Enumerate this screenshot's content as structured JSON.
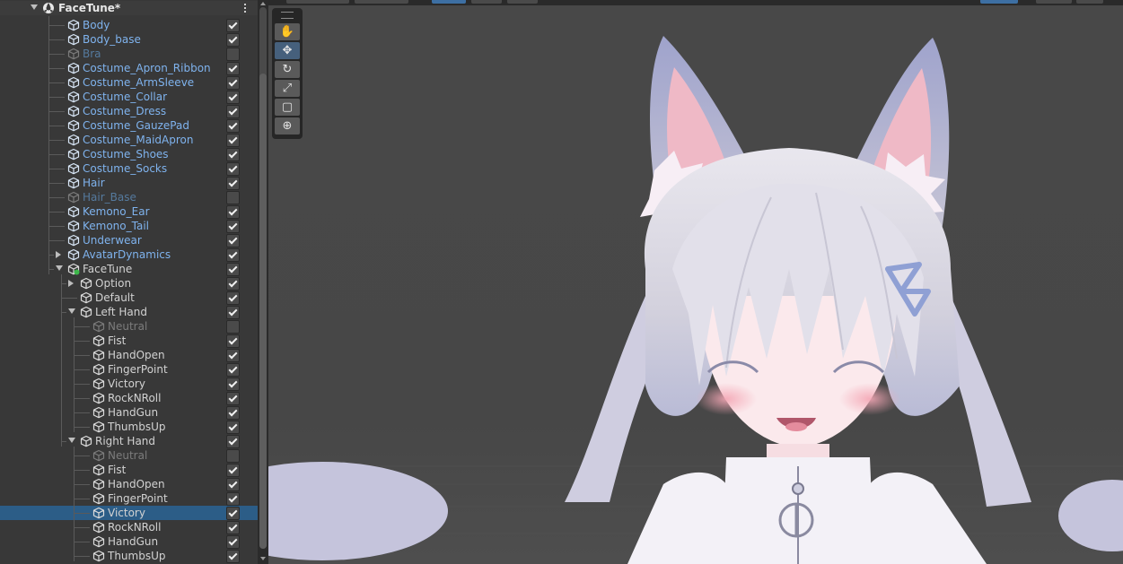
{
  "hierarchy": {
    "root_title": "FaceTune*",
    "rows": [
      {
        "label": "Body",
        "style": "prefab",
        "checked": true,
        "depth": 2
      },
      {
        "label": "Body_base",
        "style": "prefab",
        "checked": true,
        "depth": 2
      },
      {
        "label": "Bra",
        "style": "prefab-off",
        "checked": false,
        "depth": 2
      },
      {
        "label": "Costume_Apron_Ribbon",
        "style": "prefab",
        "checked": true,
        "depth": 2
      },
      {
        "label": "Costume_ArmSleeve",
        "style": "prefab",
        "checked": true,
        "depth": 2
      },
      {
        "label": "Costume_Collar",
        "style": "prefab",
        "checked": true,
        "depth": 2
      },
      {
        "label": "Costume_Dress",
        "style": "prefab",
        "checked": true,
        "depth": 2
      },
      {
        "label": "Costume_GauzePad",
        "style": "prefab",
        "checked": true,
        "depth": 2
      },
      {
        "label": "Costume_MaidApron",
        "style": "prefab",
        "checked": true,
        "depth": 2
      },
      {
        "label": "Costume_Shoes",
        "style": "prefab",
        "checked": true,
        "depth": 2
      },
      {
        "label": "Costume_Socks",
        "style": "prefab",
        "checked": true,
        "depth": 2
      },
      {
        "label": "Hair",
        "style": "prefab",
        "checked": true,
        "depth": 2
      },
      {
        "label": "Hair_Base",
        "style": "prefab-off",
        "checked": false,
        "depth": 2
      },
      {
        "label": "Kemono_Ear",
        "style": "prefab",
        "checked": true,
        "depth": 2
      },
      {
        "label": "Kemono_Tail",
        "style": "prefab",
        "checked": true,
        "depth": 2
      },
      {
        "label": "Underwear",
        "style": "prefab",
        "checked": true,
        "depth": 2
      },
      {
        "label": "AvatarDynamics",
        "style": "prefab",
        "checked": true,
        "depth": 2,
        "arrow": "right"
      },
      {
        "label": "FaceTune",
        "style": "normal",
        "checked": true,
        "depth": 2,
        "arrow": "down",
        "icon": "facetune"
      },
      {
        "label": "Option",
        "style": "normal",
        "checked": true,
        "depth": 3,
        "arrow": "right"
      },
      {
        "label": "Default",
        "style": "normal",
        "checked": true,
        "depth": 3
      },
      {
        "label": "Left Hand",
        "style": "normal",
        "checked": true,
        "depth": 3,
        "arrow": "down"
      },
      {
        "label": "Neutral",
        "style": "dim",
        "checked": false,
        "depth": 4
      },
      {
        "label": "Fist",
        "style": "normal",
        "checked": true,
        "depth": 4
      },
      {
        "label": "HandOpen",
        "style": "normal",
        "checked": true,
        "depth": 4
      },
      {
        "label": "FingerPoint",
        "style": "normal",
        "checked": true,
        "depth": 4
      },
      {
        "label": "Victory",
        "style": "normal",
        "checked": true,
        "depth": 4
      },
      {
        "label": "RockNRoll",
        "style": "normal",
        "checked": true,
        "depth": 4
      },
      {
        "label": "HandGun",
        "style": "normal",
        "checked": true,
        "depth": 4
      },
      {
        "label": "ThumbsUp",
        "style": "normal",
        "checked": true,
        "depth": 4
      },
      {
        "label": "Right Hand",
        "style": "normal",
        "checked": true,
        "depth": 3,
        "arrow": "down"
      },
      {
        "label": "Neutral",
        "style": "dim",
        "checked": false,
        "depth": 4
      },
      {
        "label": "Fist",
        "style": "normal",
        "checked": true,
        "depth": 4
      },
      {
        "label": "HandOpen",
        "style": "normal",
        "checked": true,
        "depth": 4
      },
      {
        "label": "FingerPoint",
        "style": "normal",
        "checked": true,
        "depth": 4
      },
      {
        "label": "Victory",
        "style": "normal",
        "checked": true,
        "depth": 4,
        "selected": true
      },
      {
        "label": "RockNRoll",
        "style": "normal",
        "checked": true,
        "depth": 4
      },
      {
        "label": "HandGun",
        "style": "normal",
        "checked": true,
        "depth": 4
      },
      {
        "label": "ThumbsUp",
        "style": "normal",
        "checked": true,
        "depth": 4
      }
    ]
  },
  "scene": {
    "tools": [
      {
        "name": "hand-tool",
        "glyph": "✋",
        "active": false
      },
      {
        "name": "move-tool",
        "glyph": "✥",
        "active": true
      },
      {
        "name": "rotate-tool",
        "glyph": "↻",
        "active": false
      },
      {
        "name": "scale-tool",
        "glyph": "⤢",
        "active": false
      },
      {
        "name": "rect-tool",
        "glyph": "▢",
        "active": false
      },
      {
        "name": "transform-tool",
        "glyph": "⊕",
        "active": false
      }
    ],
    "colors": {
      "background": "#474747",
      "hair": "#d9d6df",
      "hair_shadow": "#a7aac8",
      "ear_inner": "#efb9c6",
      "skin": "#fbe9ec",
      "blush": "#f6b9c3",
      "outfit": "#f3f1f7",
      "selection": "#2c5d87",
      "prefab_text": "#7fb3ee"
    }
  }
}
